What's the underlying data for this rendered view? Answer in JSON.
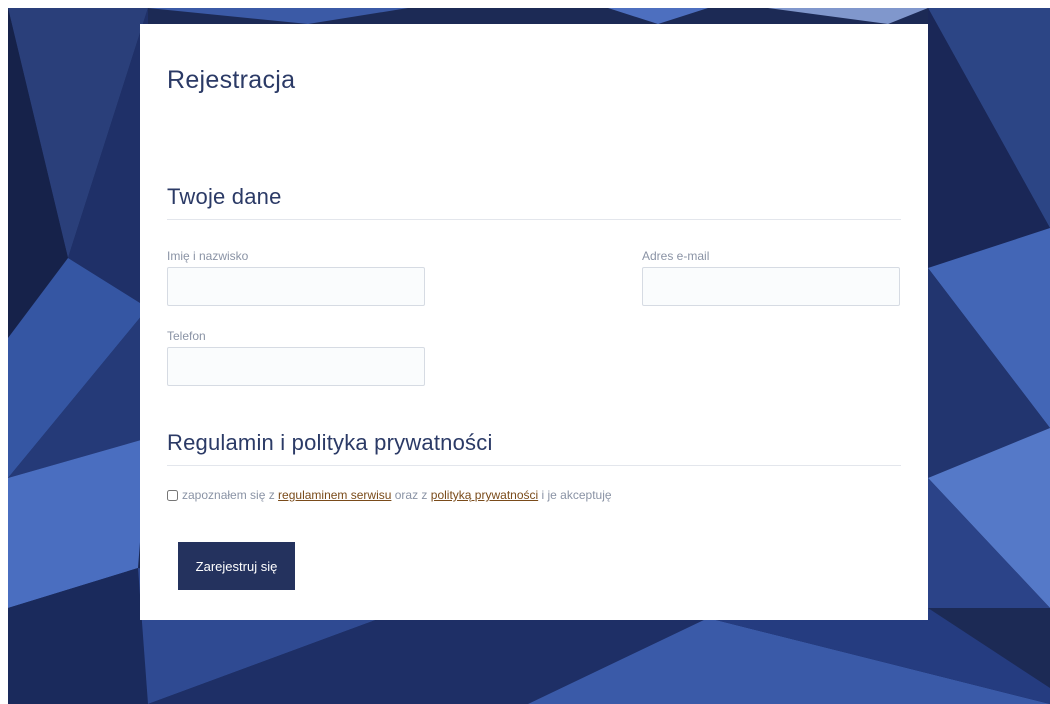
{
  "page_title": "Rejestracja",
  "sections": {
    "personal": {
      "title": "Twoje dane",
      "fields": {
        "name": {
          "label": "Imię i nazwisko",
          "value": "",
          "placeholder": ""
        },
        "email": {
          "label": "Adres e-mail",
          "value": "",
          "placeholder": ""
        },
        "phone": {
          "label": "Telefon",
          "value": "",
          "placeholder": ""
        }
      }
    },
    "terms": {
      "title": "Regulamin i polityka prywatności",
      "consent": {
        "text_before": "zapoznałem się z ",
        "terms_link": "regulaminem serwisu",
        "text_middle": " oraz z ",
        "privacy_link": "polityką prywatności",
        "text_after": " i je akceptuję",
        "checked": false
      }
    }
  },
  "submit_label": "Zarejestruj się",
  "colors": {
    "background": "#1c2a55",
    "heading": "#2b3a66",
    "button": "#24325e",
    "link": "#7a4b1a",
    "label": "#8a93a5"
  }
}
